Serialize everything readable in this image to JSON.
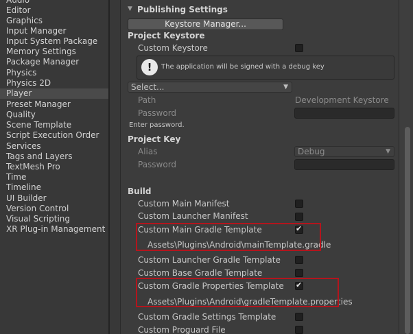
{
  "sidebar": {
    "items": [
      {
        "label": "Audio"
      },
      {
        "label": "Editor"
      },
      {
        "label": "Graphics"
      },
      {
        "label": "Input Manager"
      },
      {
        "label": "Input System Package"
      },
      {
        "label": "Memory Settings"
      },
      {
        "label": "Package Manager"
      },
      {
        "label": "Physics"
      },
      {
        "label": "Physics 2D"
      },
      {
        "label": "Player",
        "selected": true
      },
      {
        "label": "Preset Manager"
      },
      {
        "label": "Quality"
      },
      {
        "label": "Scene Template"
      },
      {
        "label": "Script Execution Order"
      },
      {
        "label": "Services"
      },
      {
        "label": "Tags and Layers"
      },
      {
        "label": "TextMesh Pro"
      },
      {
        "label": "Time"
      },
      {
        "label": "Timeline"
      },
      {
        "label": "UI Builder"
      },
      {
        "label": "Version Control"
      },
      {
        "label": "Visual Scripting"
      },
      {
        "label": "XR Plug-in Management"
      }
    ]
  },
  "publishing": {
    "title": "Publishing Settings",
    "keystore_manager_button": "Keystore Manager...",
    "project_keystore_header": "Project Keystore",
    "custom_keystore_label": "Custom Keystore",
    "custom_keystore_checked": false,
    "info_message": "The application will be signed with a debug key",
    "select_dropdown": "Select...",
    "path_label": "Path",
    "path_value": "Development Keystore",
    "password_label": "Password",
    "enter_password_hint": "Enter password.",
    "project_key_header": "Project Key",
    "alias_label": "Alias",
    "alias_value": "Debug",
    "key_password_label": "Password"
  },
  "build": {
    "header": "Build",
    "custom_main_manifest": {
      "label": "Custom Main Manifest",
      "checked": false
    },
    "custom_launcher_manifest": {
      "label": "Custom Launcher Manifest",
      "checked": false
    },
    "custom_main_gradle_template": {
      "label": "Custom Main Gradle Template",
      "checked": true,
      "path": "Assets\\Plugins\\Android\\mainTemplate.gradle"
    },
    "custom_launcher_gradle_template": {
      "label": "Custom Launcher Gradle Template",
      "checked": false
    },
    "custom_base_gradle_template": {
      "label": "Custom Base Gradle Template",
      "checked": false
    },
    "custom_gradle_properties_template": {
      "label": "Custom Gradle Properties Template",
      "checked": true,
      "path": "Assets\\Plugins\\Android\\gradleTemplate.properties"
    },
    "custom_gradle_settings_template": {
      "label": "Custom Gradle Settings Template",
      "checked": false
    },
    "custom_proguard_file": {
      "label": "Custom Proguard File",
      "checked": false
    }
  },
  "colors": {
    "highlight_box": "#b3151d",
    "selected_item_bg": "#4a4a4a"
  }
}
